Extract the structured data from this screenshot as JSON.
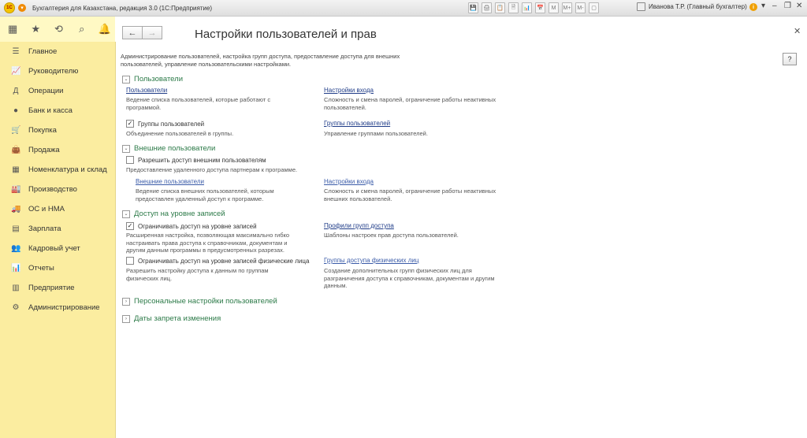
{
  "titlebar": {
    "title": "Бухгалтерия для Казахстана, редакция 3.0  (1С:Предприятие)",
    "user": "Иванова Т.Р. (Главный бухгалтер)",
    "tools": [
      "💾",
      "🖨",
      "📋",
      "🗎",
      "📊",
      "📅",
      "M",
      "M+",
      "M-",
      "▢"
    ]
  },
  "sidebar": {
    "items": [
      {
        "label": "Главное",
        "icon": "☰"
      },
      {
        "label": "Руководителю",
        "icon": "📈"
      },
      {
        "label": "Операции",
        "icon": "Д"
      },
      {
        "label": "Банк и касса",
        "icon": "●"
      },
      {
        "label": "Покупка",
        "icon": "🛒"
      },
      {
        "label": "Продажа",
        "icon": "👜"
      },
      {
        "label": "Номенклатура и склад",
        "icon": "▦"
      },
      {
        "label": "Производство",
        "icon": "🏭"
      },
      {
        "label": "ОС и НМА",
        "icon": "🚚"
      },
      {
        "label": "Зарплата",
        "icon": "▤"
      },
      {
        "label": "Кадровый учет",
        "icon": "👥"
      },
      {
        "label": "Отчеты",
        "icon": "📊"
      },
      {
        "label": "Предприятие",
        "icon": "▥"
      },
      {
        "label": "Администрирование",
        "icon": "⚙"
      }
    ]
  },
  "page": {
    "title": "Настройки пользователей и прав",
    "help": "?",
    "intro": "Администрирование пользователей, настройка групп доступа, предоставление доступа для внешних пользователей, управление пользовательскими настройками."
  },
  "users": {
    "header": "Пользователи",
    "users_link": "Пользователи",
    "users_desc": "Ведение списка пользователей, которые работают с программой.",
    "login_link": "Настройки входа",
    "login_desc": "Сложность и смена паролей, ограничение работы неактивных пользователей.",
    "groups_check": "Группы пользователей",
    "groups_check_desc": "Объединение пользователей в группы.",
    "groups_link": "Группы пользователей",
    "groups_link_desc": "Управление группами пользователей."
  },
  "external": {
    "header": "Внешние пользователи",
    "allow_check": "Разрешить доступ внешним пользователям",
    "allow_desc": "Предоставление удаленного доступа партнерам к программе.",
    "ext_link": "Внешние пользователи",
    "ext_desc": "Ведение списка внешних пользователей, которым предоставлен удаленный доступ к программе.",
    "login_link": "Настройки входа",
    "login_desc": "Сложность и смена паролей, ограничение работы неактивных внешних пользователей."
  },
  "records": {
    "header": "Доступ на уровне записей",
    "limit_check": "Ограничивать доступ на уровне записей",
    "limit_desc": "Расширенная настройка, позволяющая максимально гибко настраивать права доступа к справочникам, документам и другим данным программы в предусмотренных разрезах.",
    "profiles_link": "Профили групп доступа",
    "profiles_desc": "Шаблоны настроек прав доступа пользователей.",
    "persons_check": "Ограничивать доступ на уровне записей физические лица",
    "persons_desc": "Разрешить настройку доступа к данным по группам физических лиц.",
    "persons_link": "Группы доступа физических лиц",
    "persons_link_desc": "Создание дополнительных групп физических лиц для разграничения доступа к справочникам, документам и другим данным."
  },
  "personal": {
    "header": "Персональные настройки пользователей"
  },
  "dates": {
    "header": "Даты запрета изменения"
  }
}
